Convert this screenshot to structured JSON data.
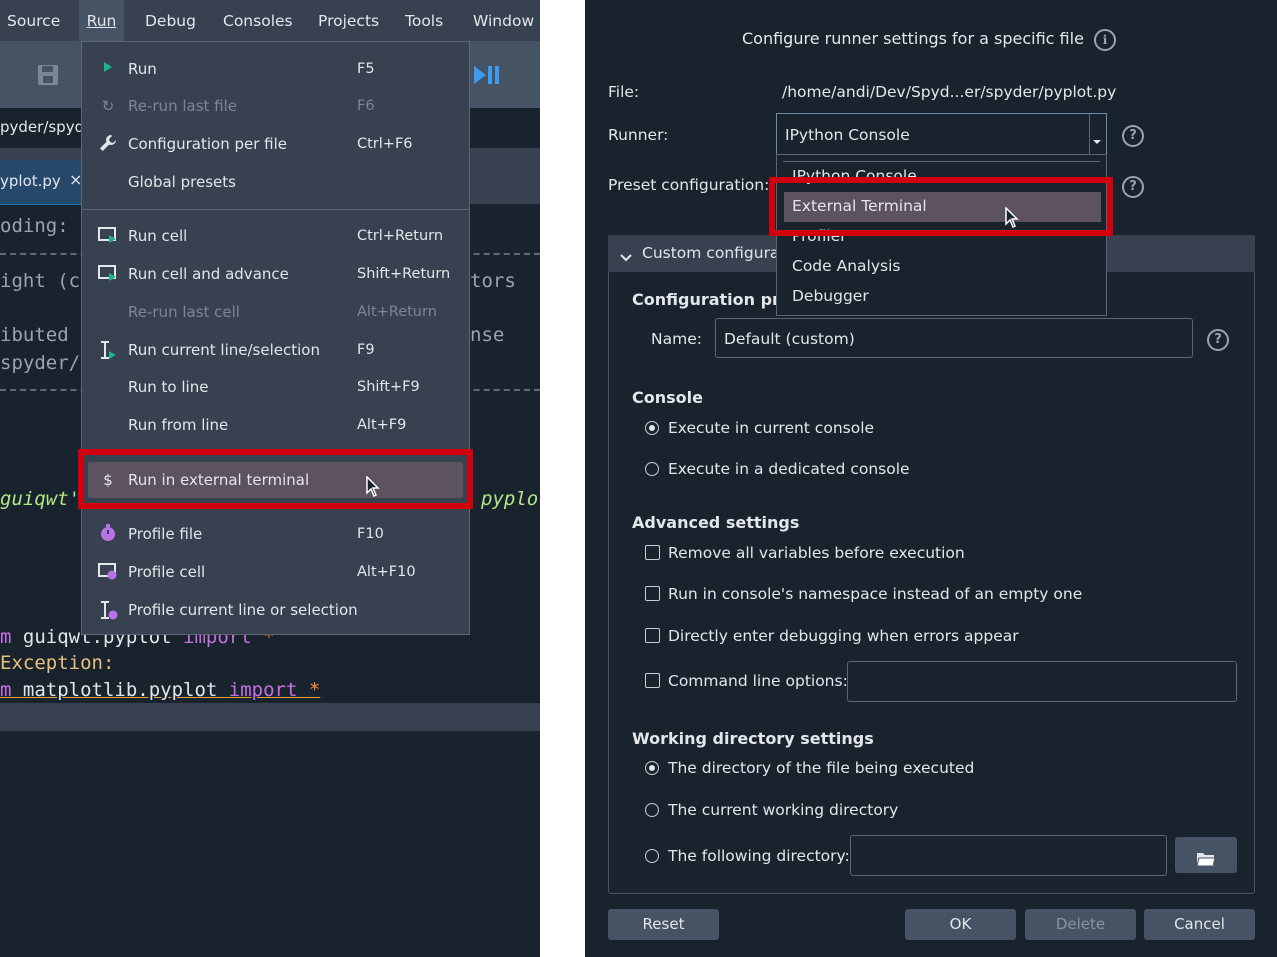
{
  "menubar": {
    "items": [
      {
        "label": "Source",
        "ul": "u"
      },
      {
        "label": "Run",
        "ul": "R"
      },
      {
        "label": "Debug",
        "ul": "D"
      },
      {
        "label": "Consoles",
        "ul": "o"
      },
      {
        "label": "Projects",
        "ul": "P"
      },
      {
        "label": "Tools",
        "ul": "T"
      },
      {
        "label": "Window",
        "ul": "W"
      }
    ]
  },
  "editor": {
    "path_fragment": "pyder/spyd",
    "tab_label": "yplot.py",
    "tab_close": "×",
    "lines": {
      "l1": "oding:",
      "l2": "ight (c",
      "l2r": "tors",
      "l3": "ibuted",
      "l3r": "nse",
      "l4": "spyder/",
      "l5a": "guiqwt'",
      "l5r": "pyplo",
      "l6a": "m ",
      "l6b": "guiqwt",
      "l6c": ".pyplot ",
      "l6d": "import",
      "l6e": " *",
      "l7": "Exception:",
      "l8a": "m ",
      "l8b": "matplotlib",
      "l8c": ".pyplot ",
      "l8d": "import",
      "l8e": " *"
    }
  },
  "run_menu": {
    "items": [
      {
        "label": "Run",
        "shortcut": "F5",
        "icon": "play-icon"
      },
      {
        "label": "Re-run last file",
        "shortcut": "F6",
        "icon": "rerun-icon"
      },
      {
        "label": "Configuration per file",
        "shortcut": "Ctrl+F6",
        "icon": "wrench-icon"
      },
      {
        "label": "Global presets",
        "shortcut": ""
      },
      {
        "label": "Run cell",
        "shortcut": "Ctrl+Return",
        "icon": "run-cell-icon"
      },
      {
        "label": "Run cell and advance",
        "shortcut": "Shift+Return",
        "icon": "run-cell-advance-icon"
      },
      {
        "label": "Re-run last cell",
        "shortcut": "Alt+Return"
      },
      {
        "label": "Run current line/selection",
        "shortcut": "F9",
        "icon": "run-selection-icon"
      },
      {
        "label": "Run to line",
        "shortcut": "Shift+F9"
      },
      {
        "label": "Run from line",
        "shortcut": "Alt+F9"
      },
      {
        "label": "Run in external terminal",
        "shortcut": "",
        "icon": "dollar-icon"
      },
      {
        "label": "Profile file",
        "shortcut": "F10",
        "icon": "stopwatch-icon"
      },
      {
        "label": "Profile cell",
        "shortcut": "Alt+F10",
        "icon": "profile-cell-icon"
      },
      {
        "label": "Profile current line or selection",
        "shortcut": "",
        "icon": "profile-selection-icon"
      }
    ]
  },
  "dialog": {
    "title": "Configure runner settings for a specific file",
    "file_label": "File:",
    "file_value": "/home/andi/Dev/Spyd...er/spyder/pyplot.py",
    "runner_label": "Runner:",
    "runner_value": "IPython Console",
    "preset_label": "Preset configuration:",
    "runner_options": [
      "IPython Console",
      "External Terminal",
      "Profiler",
      "Code Analysis",
      "Debugger"
    ],
    "group_title": "Custom configurat",
    "config_properties": "Configuration pro",
    "name_label": "Name:",
    "name_value": "Default (custom)",
    "console_title": "Console",
    "console_options": [
      "Execute in current console",
      "Execute in a dedicated console"
    ],
    "advanced_title": "Advanced settings",
    "advanced_options": [
      "Remove all variables before execution",
      "Run in console's namespace instead of an empty one",
      "Directly enter debugging when errors appear",
      "Command line options:"
    ],
    "workdir_title": "Working directory settings",
    "workdir_options": [
      "The directory of the file being executed",
      "The current working directory",
      "The following directory:"
    ],
    "buttons": {
      "reset": "Reset",
      "ok": "OK",
      "delete": "Delete",
      "cancel": "Cancel"
    }
  },
  "colors": {
    "highlight": "#d1000c",
    "keyword": "#c670e0",
    "string": "#b0e686",
    "accent": "#1a72bb"
  }
}
